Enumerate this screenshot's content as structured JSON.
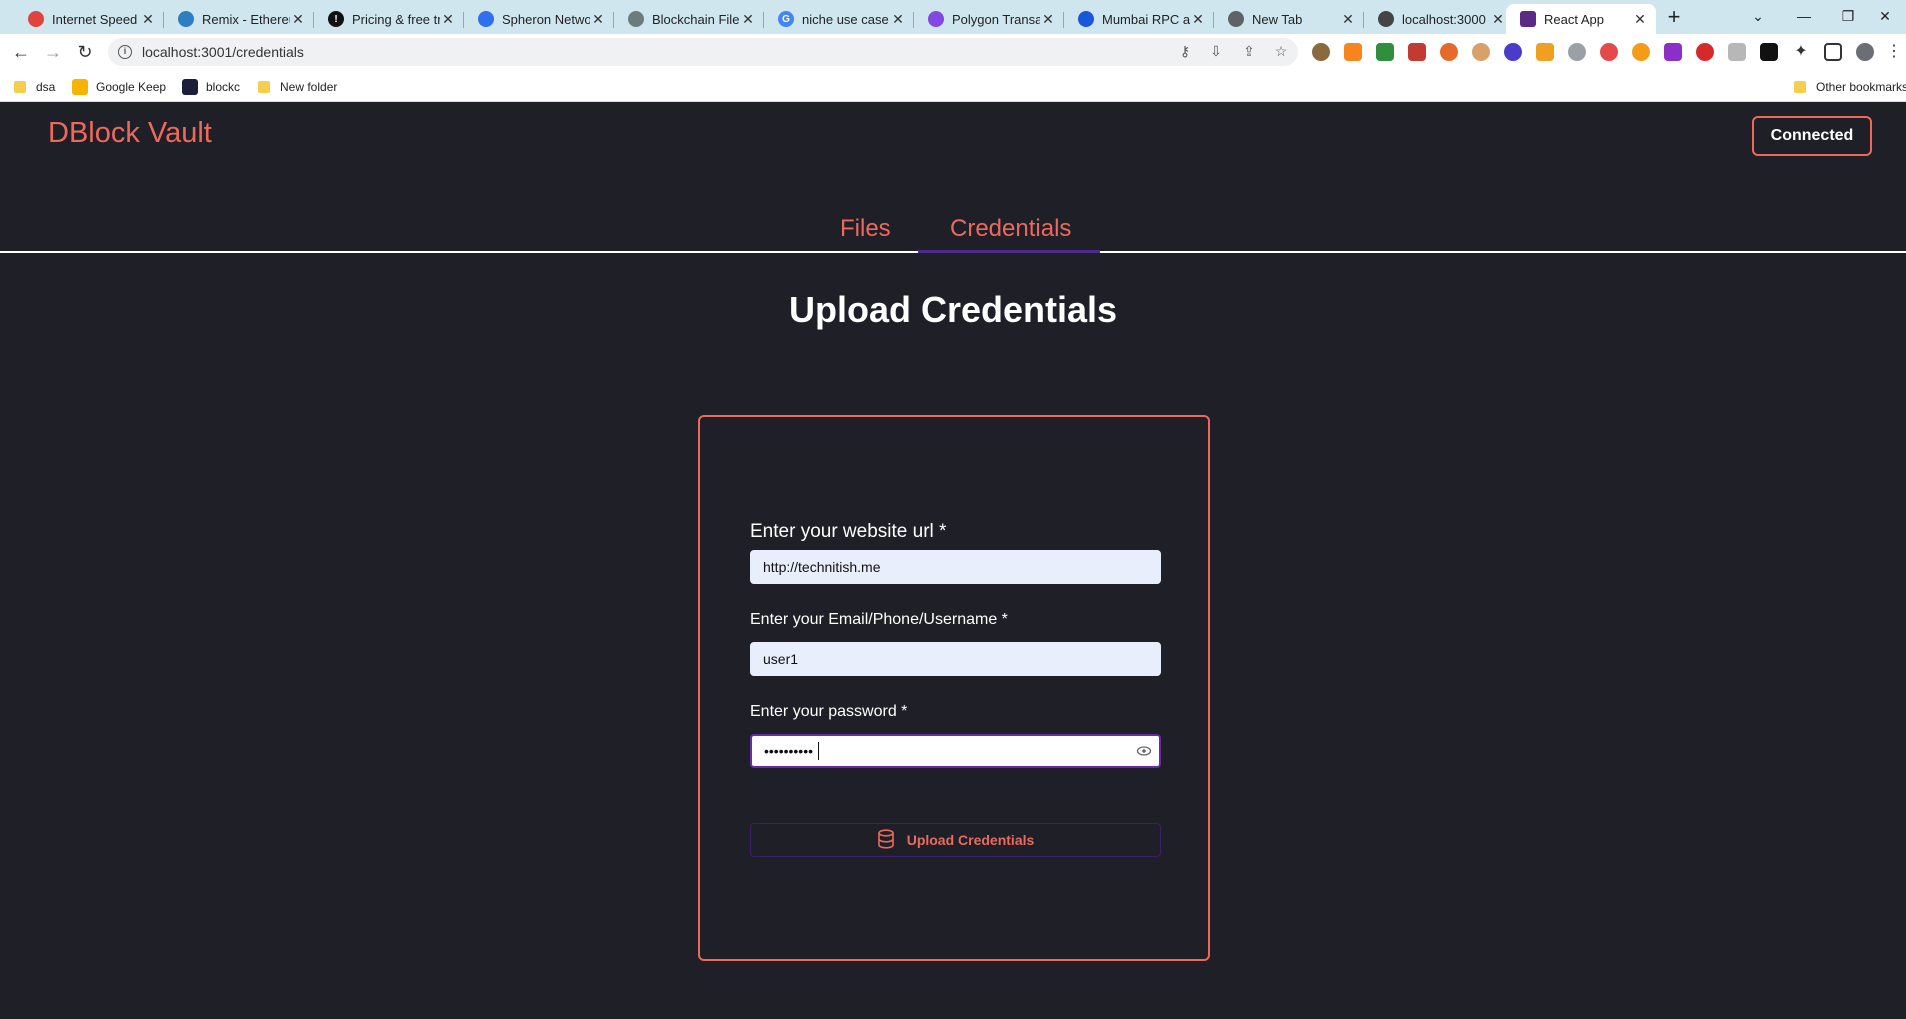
{
  "browser": {
    "tabs": [
      {
        "title": "Internet Speed T",
        "color": "#e0443e"
      },
      {
        "title": "Remix - Ethereu",
        "color": "#2d7fc1"
      },
      {
        "title": "Pricing & free tr",
        "color": "#111111"
      },
      {
        "title": "Spheron Netwo",
        "color": "#2f6ff0"
      },
      {
        "title": "Blockchain File",
        "color": "#6c7c7c"
      },
      {
        "title": "niche use case",
        "color": "#4285f4"
      },
      {
        "title": "Polygon Transa",
        "color": "#8247e5"
      },
      {
        "title": "Mumbai RPC an",
        "color": "#1a56db"
      },
      {
        "title": "New Tab",
        "color": "#5f6368"
      },
      {
        "title": "localhost:3000",
        "color": "#444444"
      },
      {
        "title": "React App",
        "color": "#5b2a86"
      }
    ],
    "active_tab_index": 10,
    "url": "localhost:3001/credentials",
    "bookmarks": [
      {
        "label": "dsa",
        "icon": "folder-icon"
      },
      {
        "label": "Google Keep",
        "icon": "keep-icon"
      },
      {
        "label": "blockc",
        "icon": "blockc-icon"
      },
      {
        "label": "New folder",
        "icon": "folder-icon"
      }
    ],
    "other_bookmarks": "Other bookmarks"
  },
  "app": {
    "brand": "DBlock Vault",
    "connect_button": "Connected",
    "nav_tabs": [
      "Files",
      "Credentials"
    ],
    "active_nav_tab": "Credentials",
    "page_title": "Upload Credentials",
    "form": {
      "url_label": "Enter your website url *",
      "url_value": "http://technitish.me",
      "user_label": "Enter your Email/Phone/Username *",
      "user_value": "user1",
      "password_label": "Enter your password *",
      "password_value": "••••••••••",
      "submit_label": "Upload Credentials"
    },
    "colors": {
      "accent": "#ec6a5c",
      "background": "#1e1f27",
      "focus": "#6a2aa8"
    }
  }
}
